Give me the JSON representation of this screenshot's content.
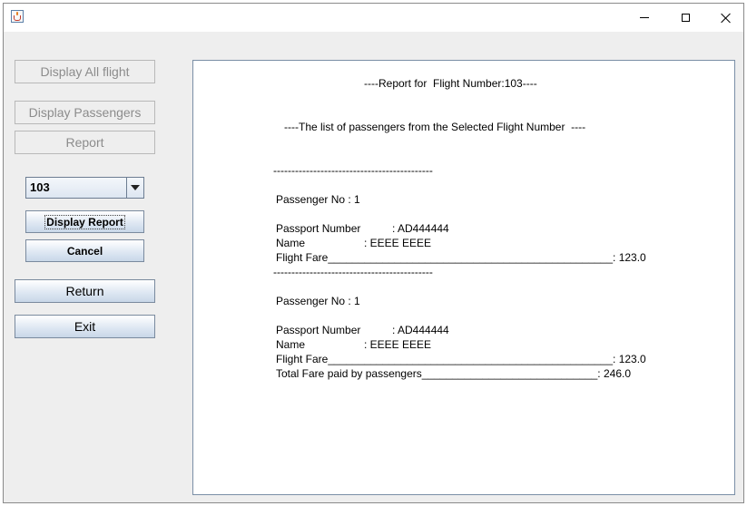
{
  "window": {
    "title": "",
    "icon": "java-cup-icon",
    "controls": {
      "minimize": "minimize-icon",
      "maximize": "maximize-icon",
      "close": "close-icon"
    }
  },
  "sidebar": {
    "display_all_flight": "Display All flight",
    "display_passengers": "Display Passengers",
    "report": "Report",
    "flight_select": {
      "value": "103"
    },
    "display_report": "Display Report",
    "cancel": "Cancel",
    "return": "Return",
    "exit": "Exit"
  },
  "report": {
    "header": "----Report for  Flight Number:103----",
    "subheader": "----The list of passengers from the Selected Flight Number  ----",
    "separator": "--------------------------------------------",
    "passengers": [
      {
        "passenger_no": "Passenger No : 1",
        "passport_label": "Passport Number",
        "passport_value": ": AD444444",
        "name_label": "Name",
        "name_value": ": EEEE EEEE",
        "fare_line": "Flight Fare_______________________________________________: 123.0"
      },
      {
        "passenger_no": "Passenger No : 1",
        "passport_label": "Passport Number",
        "passport_value": ": AD444444",
        "name_label": "Name",
        "name_value": ": EEEE EEEE",
        "fare_line": "Flight Fare_______________________________________________: 123.0"
      }
    ],
    "total_line": "Total Fare paid by passengers_____________________________: 246.0"
  },
  "colors": {
    "window_bg": "#eeeeee",
    "button_border": "#7a8a9e",
    "disabled_text": "#8c8c8c",
    "panel_border": "#7a8fa6"
  }
}
